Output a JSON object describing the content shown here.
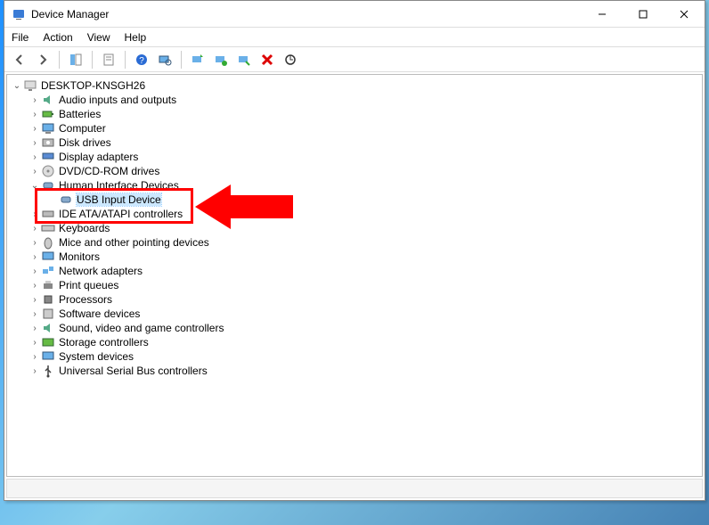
{
  "window": {
    "title": "Device Manager"
  },
  "menu": {
    "file": "File",
    "action": "Action",
    "view": "View",
    "help": "Help"
  },
  "toolbar_icons": {
    "back": "back-icon",
    "forward": "forward-icon",
    "show_hide": "show-hide-tree-icon",
    "properties": "properties-icon",
    "help": "help-icon",
    "scan": "scan-hardware-icon",
    "update": "update-driver-icon",
    "add_legacy": "add-legacy-hardware-icon",
    "uninstall": "uninstall-device-icon",
    "disable": "disable-device-icon",
    "remove": "remove-icon",
    "refresh": "refresh-icon"
  },
  "tree": {
    "root": "DESKTOP-KNSGH26",
    "items": [
      {
        "label": "Audio inputs and outputs",
        "icon": "audio-icon"
      },
      {
        "label": "Batteries",
        "icon": "battery-icon"
      },
      {
        "label": "Computer",
        "icon": "computer-icon"
      },
      {
        "label": "Disk drives",
        "icon": "disk-icon"
      },
      {
        "label": "Display adapters",
        "icon": "display-adapter-icon"
      },
      {
        "label": "DVD/CD-ROM drives",
        "icon": "dvd-icon"
      },
      {
        "label": "Human Interface Devices",
        "icon": "hid-icon",
        "expanded": true,
        "children": [
          {
            "label": "USB Input Device",
            "icon": "hid-icon",
            "selected": true
          }
        ]
      },
      {
        "label": "IDE ATA/ATAPI controllers",
        "icon": "ide-icon"
      },
      {
        "label": "Keyboards",
        "icon": "keyboard-icon"
      },
      {
        "label": "Mice and other pointing devices",
        "icon": "mouse-icon"
      },
      {
        "label": "Monitors",
        "icon": "monitor-icon"
      },
      {
        "label": "Network adapters",
        "icon": "network-icon"
      },
      {
        "label": "Print queues",
        "icon": "printer-icon"
      },
      {
        "label": "Processors",
        "icon": "cpu-icon"
      },
      {
        "label": "Software devices",
        "icon": "software-icon"
      },
      {
        "label": "Sound, video and game controllers",
        "icon": "sound-icon"
      },
      {
        "label": "Storage controllers",
        "icon": "storage-icon"
      },
      {
        "label": "System devices",
        "icon": "system-icon"
      },
      {
        "label": "Universal Serial Bus controllers",
        "icon": "usb-icon"
      }
    ]
  },
  "annotation": {
    "highlight_target": "Human Interface Devices / USB Input Device"
  }
}
